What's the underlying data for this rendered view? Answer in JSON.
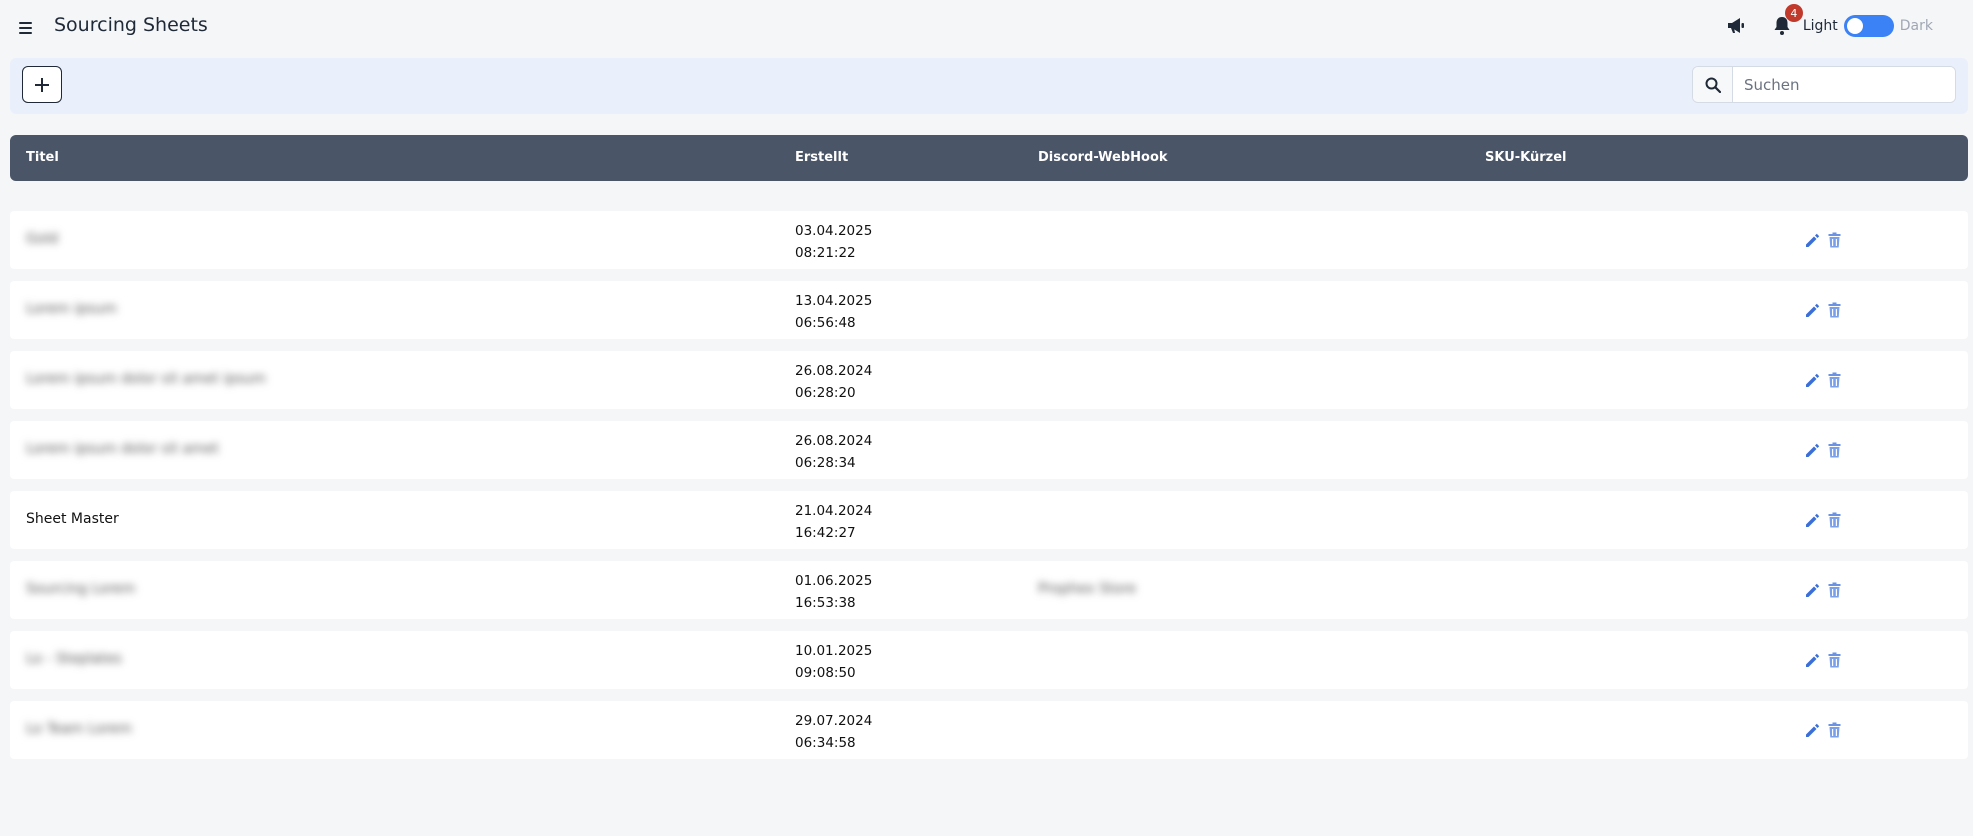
{
  "header": {
    "title": "Sourcing Sheets",
    "notification_count": "4",
    "theme_light_label": "Light",
    "theme_dark_label": "Dark"
  },
  "toolbar": {
    "add_label": "+",
    "search_placeholder": "Suchen"
  },
  "table": {
    "columns": [
      "Titel",
      "Erstellt",
      "Discord-WebHook",
      "SKU-Kürzel"
    ],
    "rows": [
      {
        "title": "Gold",
        "title_blurred": true,
        "date": "03.04.2025",
        "time": "08:21:22",
        "webhook": "",
        "sku": ""
      },
      {
        "title": "Lorem ipsum",
        "title_blurred": true,
        "date": "13.04.2025",
        "time": "06:56:48",
        "webhook": "",
        "sku": ""
      },
      {
        "title": "Lorem ipsum dolor sit amet ipsum",
        "title_blurred": true,
        "date": "26.08.2024",
        "time": "06:28:20",
        "webhook": "",
        "sku": ""
      },
      {
        "title": "Lorem ipsum dolor sit amet",
        "title_blurred": true,
        "date": "26.08.2024",
        "time": "06:28:34",
        "webhook": "",
        "sku": ""
      },
      {
        "title": "Sheet Master",
        "title_blurred": false,
        "date": "21.04.2024",
        "time": "16:42:27",
        "webhook": "",
        "sku": ""
      },
      {
        "title": "Sourcing Lorem",
        "title_blurred": true,
        "date": "01.06.2025",
        "time": "16:53:38",
        "webhook": "Prophex Store",
        "sku": ""
      },
      {
        "title": "Lo - Steplates",
        "title_blurred": true,
        "date": "10.01.2025",
        "time": "09:08:50",
        "webhook": "",
        "sku": ""
      },
      {
        "title": "Lo Team Lorem",
        "title_blurred": true,
        "date": "29.07.2024",
        "time": "06:34:58",
        "webhook": "",
        "sku": ""
      }
    ]
  },
  "colors": {
    "header_bg": "#4a5568",
    "accent": "#3b82f6",
    "badge": "#c0392b"
  }
}
